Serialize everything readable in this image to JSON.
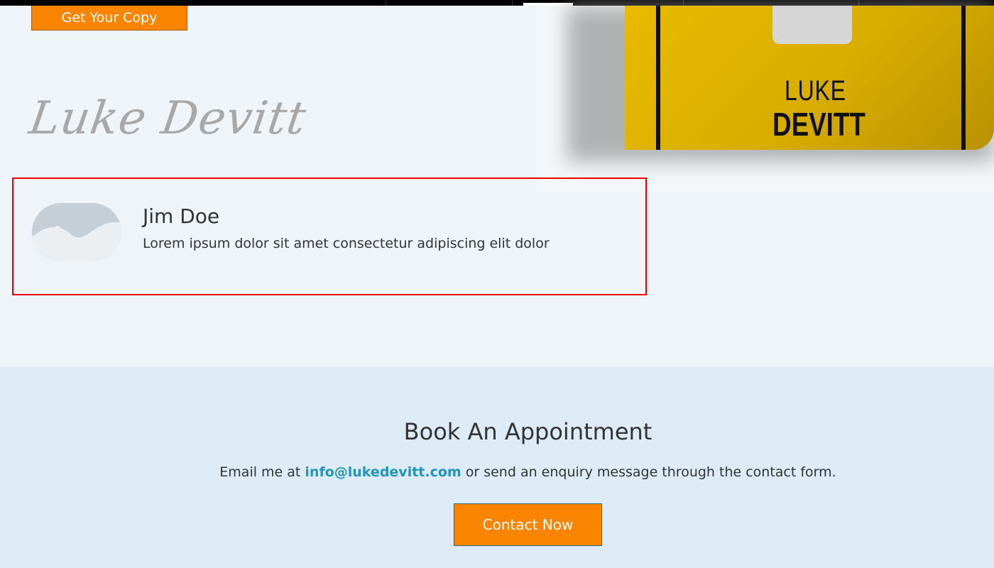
{
  "hero": {
    "get_copy_label": "Get Your Copy",
    "signature": "Luke Devitt",
    "book": {
      "title_line1": "LUKE",
      "title_line2": "DEVITT",
      "color": "#e3b600"
    }
  },
  "testimonial": {
    "name": "Jim Doe",
    "quote": "Lorem ipsum dolor sit amet consectetur adipiscing elit dolor",
    "avatar_icon": "image-placeholder-icon",
    "highlight_color": "#ee0000"
  },
  "appointment": {
    "title": "Book An Appointment",
    "text_before": "Email me at ",
    "email": "info@lukedevitt.com",
    "text_after": " or send an enquiry message through the contact form.",
    "button_label": "Contact Now"
  },
  "colors": {
    "accent": "#fb8500",
    "link": "#2196b8",
    "upper_bg": "#eff4f9",
    "lower_bg": "#dcebf5"
  }
}
